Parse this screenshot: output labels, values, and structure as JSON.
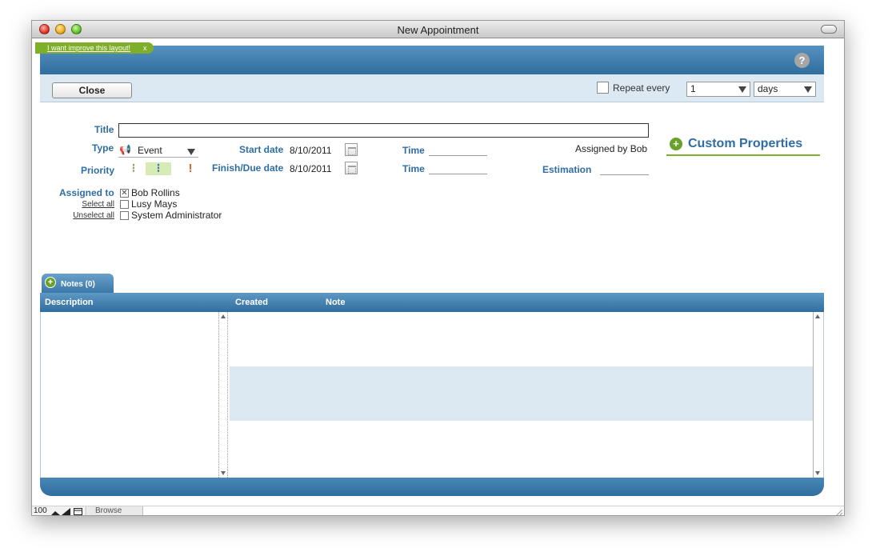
{
  "window": {
    "title": "New Appointment"
  },
  "feedback": {
    "link": "I want improve this layout!",
    "close": "x"
  },
  "header": {
    "help": "?"
  },
  "toolbar": {
    "close_label": "Close",
    "repeat_label": "Repeat every",
    "repeat_count": "1",
    "repeat_unit": "days"
  },
  "form": {
    "title_label": "Title",
    "title_value": "",
    "type_label": "Type",
    "type_value": "Event",
    "start_label": "Start date",
    "start_value": "8/10/2011",
    "finish_label": "Finish/Due date",
    "finish_value": "8/10/2011",
    "time_label": "Time",
    "assigned_by": "Assigned by Bob",
    "estimation_label": "Estimation",
    "priority_label": "Priority",
    "assigned_to_label": "Assigned to",
    "select_all": "Select all",
    "unselect_all": "Unselect all",
    "assignees": [
      {
        "name": "Bob Rollins",
        "checked": true
      },
      {
        "name": "Lusy Mays",
        "checked": false
      },
      {
        "name": "System Administrator",
        "checked": false
      }
    ]
  },
  "custom": {
    "title": "Custom Properties"
  },
  "notes": {
    "tab_label": "Notes (0)",
    "columns": [
      "Description",
      "Created",
      "Note"
    ]
  },
  "statusbar": {
    "zoom": "100",
    "mode": "Browse"
  },
  "colors": {
    "accent": "#2f6da3",
    "band": "#3b77a8",
    "green": "#7fae2a"
  }
}
